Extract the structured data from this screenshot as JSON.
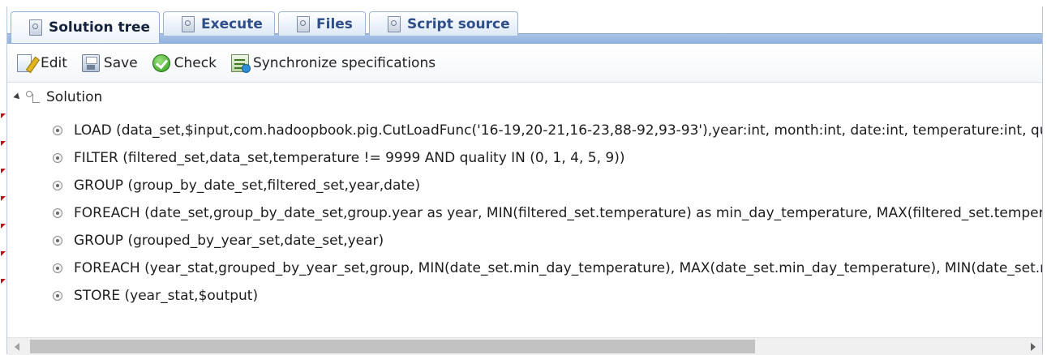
{
  "tabs": [
    {
      "label": "Solution tree",
      "active": true
    },
    {
      "label": "Execute",
      "active": false
    },
    {
      "label": "Files",
      "active": false
    },
    {
      "label": "Script source",
      "active": false
    }
  ],
  "toolbar": {
    "edit_label": "Edit",
    "save_label": "Save",
    "check_label": "Check",
    "sync_label": "Synchronize specifications"
  },
  "tree": {
    "root_label": "Solution",
    "items": [
      "LOAD (data_set,$input,com.hadoopbook.pig.CutLoadFunc('16-19,20-21,16-23,88-92,93-93'),year:int, month:int, date:int, temperature:int, quality:int)",
      "FILTER (filtered_set,data_set,temperature != 9999 AND quality IN (0, 1, 4, 5, 9))",
      "GROUP (group_by_date_set,filtered_set,year,date)",
      "FOREACH (date_set,group_by_date_set,group.year as year, MIN(filtered_set.temperature) as min_day_temperature, MAX(filtered_set.temperature) as max_day_temperature)",
      "GROUP (grouped_by_year_set,date_set,year)",
      "FOREACH (year_stat,grouped_by_year_set,group, MIN(date_set.min_day_temperature), MAX(date_set.min_day_temperature), MIN(date_set.max_day_temperature))",
      "STORE (year_stat,$output)"
    ]
  },
  "colors": {
    "tab_text": "#15233d",
    "tab_bar": "#a9c3e6",
    "error_marker": "#b8141a",
    "check_green": "#2f9a1c"
  },
  "icons": {
    "tabs": "document-icon",
    "edit": "edit-icon",
    "save": "save-icon",
    "check": "check-icon",
    "sync": "synchronize-icon",
    "root": "tree-icon",
    "item": "radio-node-icon"
  }
}
